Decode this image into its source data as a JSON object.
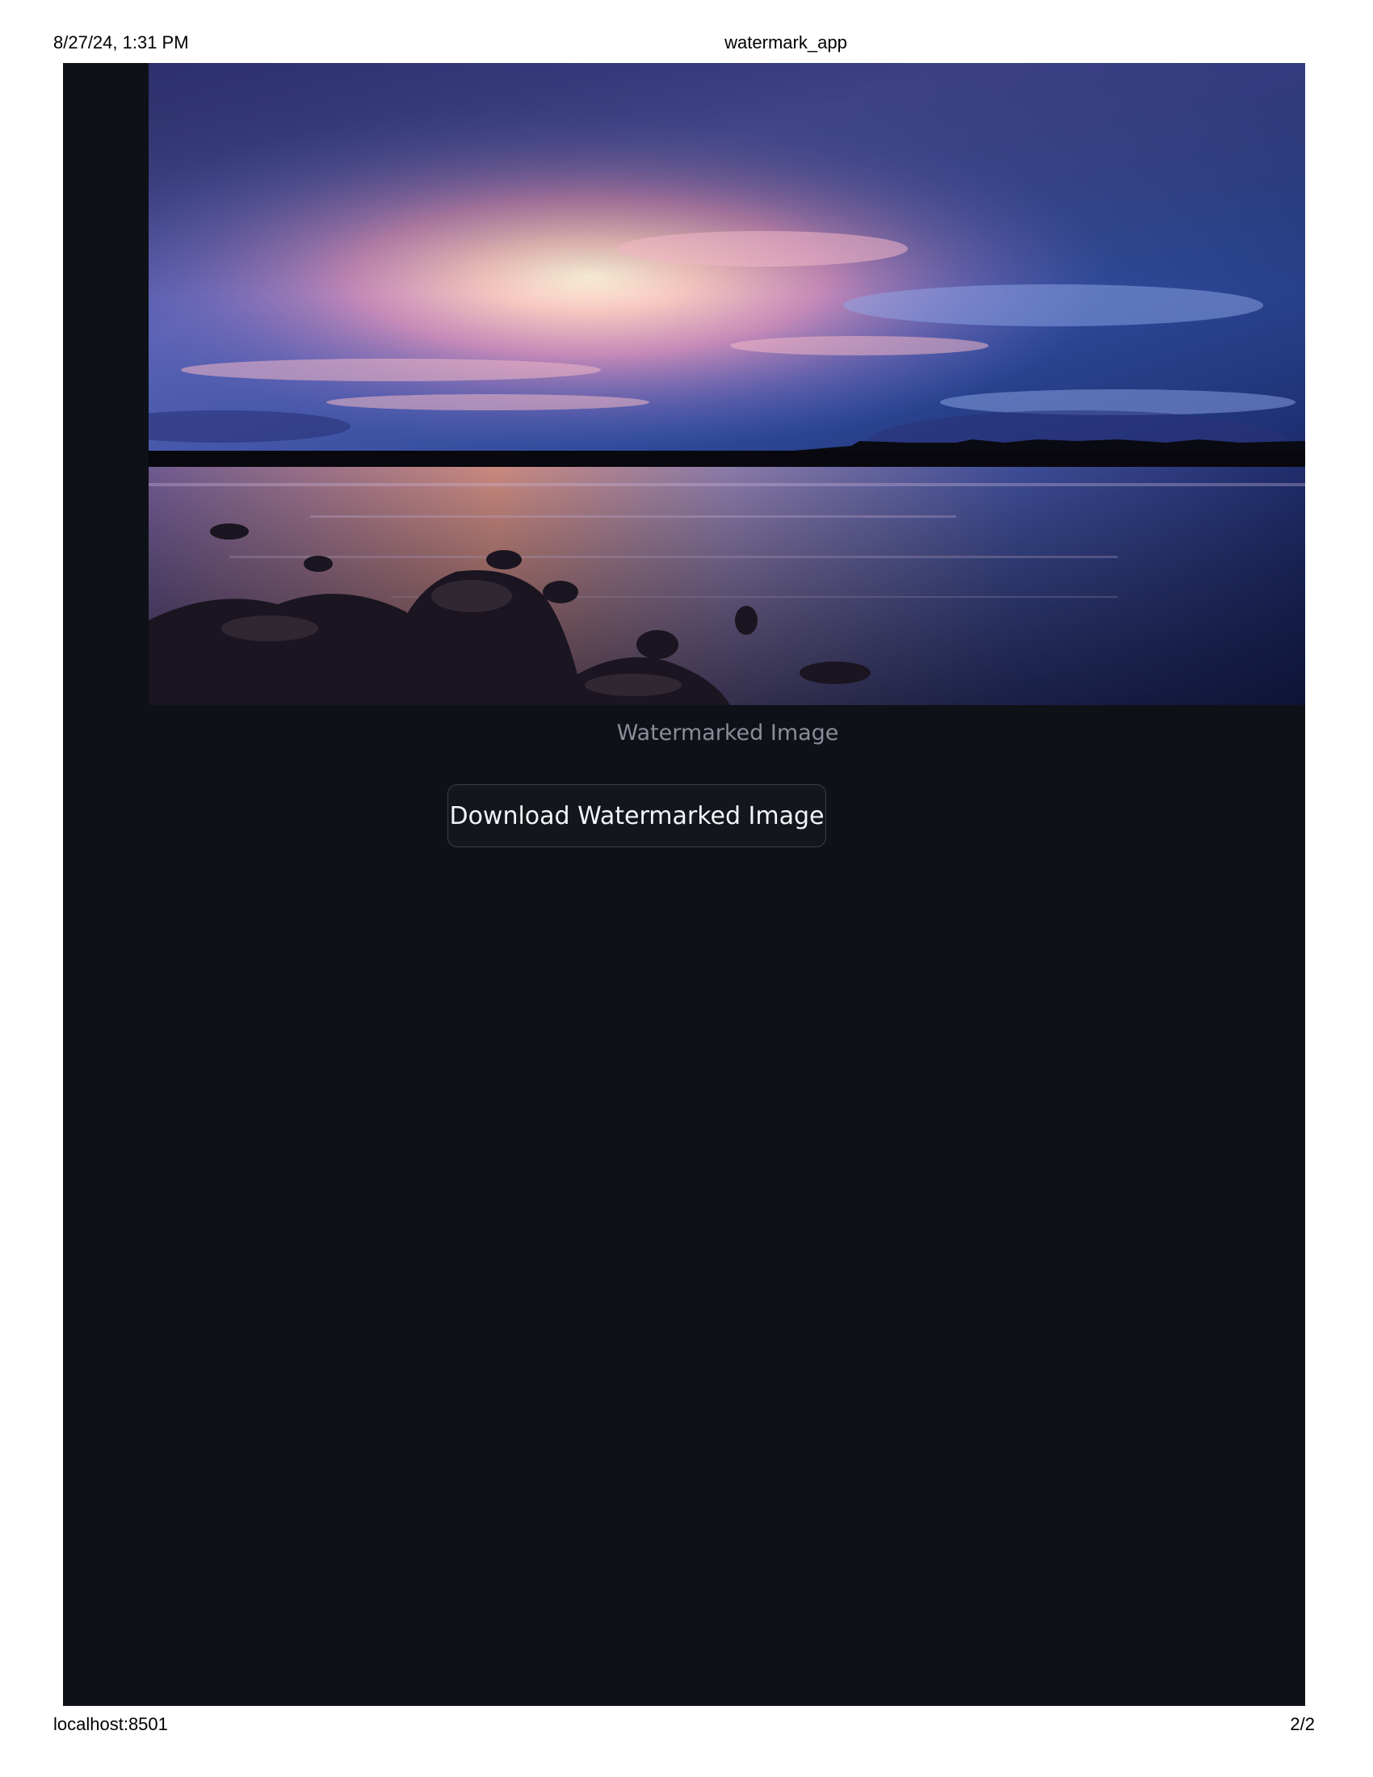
{
  "print_header": {
    "datetime": "8/27/24, 1:31 PM",
    "title": "watermark_app"
  },
  "print_footer": {
    "url": "localhost:8501",
    "page": "2/2"
  },
  "app": {
    "background_color": "#0e1117",
    "image": {
      "description_icon": "sunset-lake-photo"
    },
    "caption": "Watermarked Image",
    "download_button_label": "Download Watermarked Image"
  }
}
